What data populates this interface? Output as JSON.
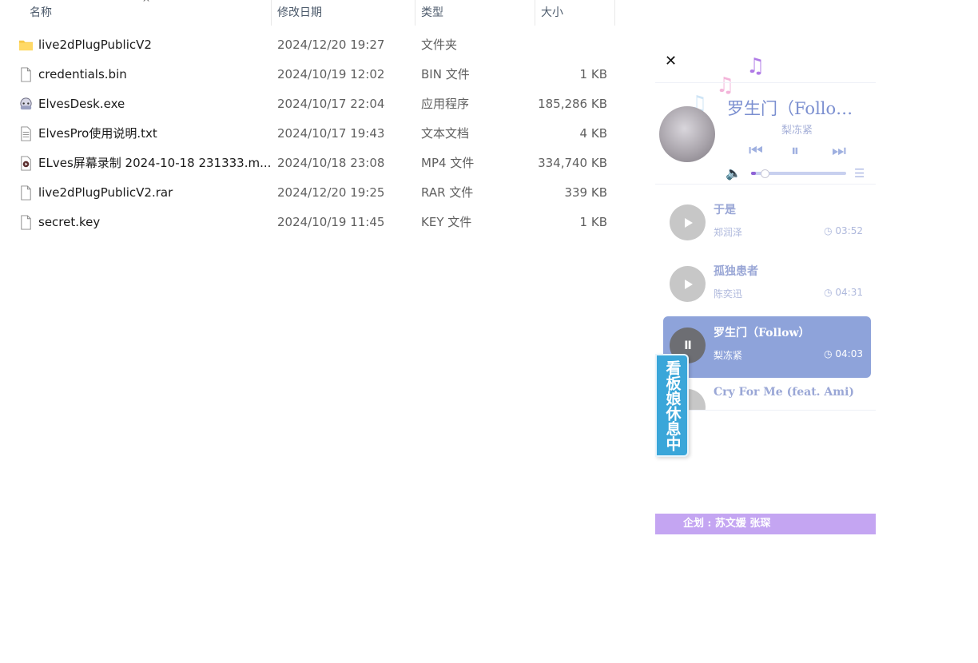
{
  "explorer": {
    "headers": {
      "name": "名称",
      "date": "修改日期",
      "type": "类型",
      "size": "大小"
    },
    "files": [
      {
        "name": "live2dPlugPublicV2",
        "date": "2024/12/20 19:27",
        "type": "文件夹",
        "size": "",
        "icon": "folder-icon"
      },
      {
        "name": "credentials.bin",
        "date": "2024/10/19 12:02",
        "type": "BIN 文件",
        "size": "1 KB",
        "icon": "file-icon"
      },
      {
        "name": "ElvesDesk.exe",
        "date": "2024/10/17 22:04",
        "type": "应用程序",
        "size": "185,286 KB",
        "icon": "app-icon"
      },
      {
        "name": "ElvesPro使用说明.txt",
        "date": "2024/10/17 19:43",
        "type": "文本文档",
        "size": "4 KB",
        "icon": "text-file-icon"
      },
      {
        "name": "ELves屏幕录制 2024-10-18 231333.m...",
        "date": "2024/10/18 23:08",
        "type": "MP4 文件",
        "size": "334,740 KB",
        "icon": "video-file-icon"
      },
      {
        "name": "live2dPlugPublicV2.rar",
        "date": "2024/12/20 19:25",
        "type": "RAR 文件",
        "size": "339 KB",
        "icon": "file-icon"
      },
      {
        "name": "secret.key",
        "date": "2024/10/19 11:45",
        "type": "KEY 文件",
        "size": "1 KB",
        "icon": "file-icon"
      }
    ]
  },
  "player": {
    "close": "✕",
    "now_playing": {
      "title": "罗生门（Follo…",
      "artist": "梨冻紧",
      "progress": 0.05
    },
    "tracks": [
      {
        "title": "于是",
        "artist": "郑润泽",
        "duration": "03:52",
        "active": false
      },
      {
        "title": "孤独患者",
        "artist": "陈奕迅",
        "duration": "04:31",
        "active": false
      },
      {
        "title": "罗生门（Follow）",
        "artist": "梨冻紧",
        "duration": "04:03",
        "active": true
      },
      {
        "title": "Cry For Me (feat. Ami)",
        "artist": "",
        "duration": "",
        "active": false
      }
    ],
    "kanban_label": "看板娘休息中",
    "credit": "企划 : 苏文媛 张琛",
    "colors": {
      "accent": "#8ea3da",
      "title": "#7b8fd0",
      "credit_bg": "#c4a5f2",
      "kanban_bg": "#3aa6d9"
    }
  }
}
